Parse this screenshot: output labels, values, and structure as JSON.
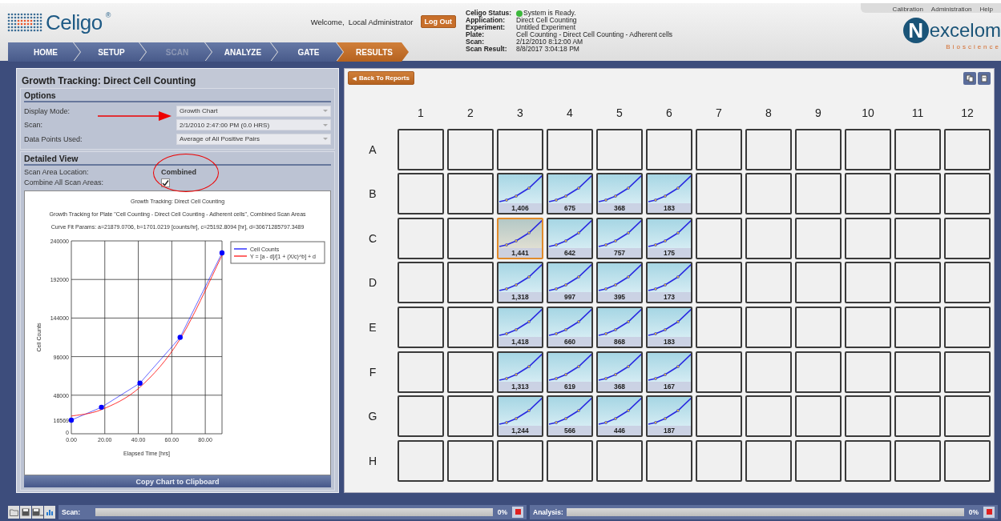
{
  "header": {
    "logo": "Celigo",
    "registered": "®",
    "welcome": "Welcome,",
    "user": "Local Administrator",
    "logout": "Log Out"
  },
  "nav": [
    {
      "label": "HOME",
      "selected": false,
      "disabled": false
    },
    {
      "label": "SETUP",
      "selected": false,
      "disabled": false
    },
    {
      "label": "SCAN",
      "selected": false,
      "disabled": true
    },
    {
      "label": "ANALYZE",
      "selected": false,
      "disabled": false
    },
    {
      "label": "GATE",
      "selected": false,
      "disabled": false
    },
    {
      "label": "RESULTS",
      "selected": true,
      "disabled": false
    }
  ],
  "status": [
    {
      "label": "Celigo Status:",
      "value": "System is Ready.",
      "color": "#3cb83c"
    },
    {
      "label": "Application:",
      "value": "Direct Cell Counting"
    },
    {
      "label": "Experiment:",
      "value": "Untitled Experiment"
    },
    {
      "label": "Plate:",
      "value": "Cell Counting - Direct Cell Counting - Adherent cells"
    },
    {
      "label": "Scan:",
      "value": "2/12/2010 8:12:00 AM"
    },
    {
      "label": "Scan Result:",
      "value": "8/8/2017 3:04:18 PM"
    }
  ],
  "top_links": [
    "Calibration",
    "Administration",
    "Help"
  ],
  "brand": {
    "name": "excelom",
    "initial": "N",
    "tagline": "Bioscience"
  },
  "left_panel": {
    "title": "Growth Tracking: Direct Cell Counting",
    "options": {
      "heading": "Options",
      "fields": [
        {
          "label": "Display Mode:",
          "value": "Growth Chart"
        },
        {
          "label": "Scan:",
          "value": "2/1/2010 2:47:00 PM (0.0 HRS)"
        },
        {
          "label": "Data Points Used:",
          "value": "Average of All Positive Pairs"
        }
      ]
    },
    "detailed_view": {
      "heading": "Detailed View",
      "scan_area_label": "Scan Area Location:",
      "scan_area_value": "Combined",
      "combine_label": "Combine All Scan Areas:",
      "combine_checked": true
    },
    "chart": {
      "lines": [
        "Growth Tracking: Direct Cell Counting",
        "Growth Tracking for Plate \"Cell Counting - Direct Cell Counting - Adherent cells\", Combined Scan Areas",
        "Curve Fit Params: a=21879.0706, b=1701.0219 [counts/hr], c=25192.8094 [hr], d=30671285797.3489"
      ],
      "chart_data": {
        "type": "line",
        "xlabel": "Elapsed Time [hrs]",
        "ylabel": "Cell Counts",
        "x": [
          0,
          18,
          41,
          65,
          90
        ],
        "series": [
          {
            "name": "Cell Counts",
            "color": "#0000ff",
            "marker": "circle",
            "values": [
              17000,
              33000,
              63000,
              120000,
              225000
            ]
          },
          {
            "name": "Y = [a - d]/[1 + (X/c)^b] + d",
            "color": "#ff0000",
            "values": [
              22000,
              30000,
              58000,
              118000,
              222000
            ]
          }
        ],
        "xlim": [
          0,
          90
        ],
        "ylim": [
          0,
          240000
        ],
        "xticks": [
          {
            "value": 0,
            "label": "0.00"
          },
          {
            "value": 20,
            "label": "20.00"
          },
          {
            "value": 40,
            "label": "40.00"
          },
          {
            "value": 60,
            "label": "60.00"
          },
          {
            "value": 80,
            "label": "80.00"
          }
        ],
        "yticks": [
          0,
          {
            "value": 16569,
            "label": "16569"
          },
          48000,
          96000,
          144000,
          192000,
          240000
        ],
        "grid": true,
        "legend": "upper right"
      }
    },
    "copy_button": "Copy Chart to Clipboard"
  },
  "plate": {
    "back_icon": "◀",
    "back_button": "Back To Reports",
    "columns": [
      "1",
      "2",
      "3",
      "4",
      "5",
      "6",
      "7",
      "8",
      "9",
      "10",
      "11",
      "12"
    ],
    "rows": [
      {
        "label": "A",
        "wells": [
          {
            "kind": "empty",
            "selected": false
          },
          {
            "kind": "empty",
            "selected": false
          },
          {
            "kind": "empty",
            "selected": false
          },
          {
            "kind": "empty",
            "selected": false
          },
          {
            "kind": "empty",
            "selected": false
          },
          {
            "kind": "empty",
            "selected": false
          },
          {
            "kind": "empty",
            "selected": false
          },
          {
            "kind": "empty",
            "selected": false
          },
          {
            "kind": "empty",
            "selected": false
          },
          {
            "kind": "empty",
            "selected": false
          },
          {
            "kind": "empty",
            "selected": false
          },
          {
            "kind": "empty",
            "selected": false
          }
        ]
      },
      {
        "label": "B",
        "wells": [
          {
            "kind": "empty",
            "selected": false
          },
          {
            "kind": "empty",
            "selected": false
          },
          {
            "kind": "chart",
            "count": "1,406",
            "selected": false
          },
          {
            "kind": "chart",
            "count": "675",
            "selected": false
          },
          {
            "kind": "chart",
            "count": "368",
            "selected": false
          },
          {
            "kind": "chart",
            "count": "183",
            "selected": false
          },
          {
            "kind": "empty",
            "selected": false
          },
          {
            "kind": "empty",
            "selected": false
          },
          {
            "kind": "empty",
            "selected": false
          },
          {
            "kind": "empty",
            "selected": false
          },
          {
            "kind": "empty",
            "selected": false
          },
          {
            "kind": "empty",
            "selected": false
          }
        ]
      },
      {
        "label": "C",
        "wells": [
          {
            "kind": "empty",
            "selected": false
          },
          {
            "kind": "empty",
            "selected": false
          },
          {
            "kind": "chart",
            "count": "1,441",
            "selected": true
          },
          {
            "kind": "chart",
            "count": "642",
            "selected": false
          },
          {
            "kind": "chart",
            "count": "757",
            "selected": false
          },
          {
            "kind": "chart",
            "count": "175",
            "selected": false
          },
          {
            "kind": "empty",
            "selected": false
          },
          {
            "kind": "empty",
            "selected": false
          },
          {
            "kind": "empty",
            "selected": false
          },
          {
            "kind": "empty",
            "selected": false
          },
          {
            "kind": "empty",
            "selected": false
          },
          {
            "kind": "empty",
            "selected": false
          }
        ]
      },
      {
        "label": "D",
        "wells": [
          {
            "kind": "empty",
            "selected": false
          },
          {
            "kind": "empty",
            "selected": false
          },
          {
            "kind": "chart",
            "count": "1,318",
            "selected": false
          },
          {
            "kind": "chart",
            "count": "997",
            "selected": false
          },
          {
            "kind": "chart",
            "count": "395",
            "selected": false
          },
          {
            "kind": "chart",
            "count": "173",
            "selected": false
          },
          {
            "kind": "empty",
            "selected": false
          },
          {
            "kind": "empty",
            "selected": false
          },
          {
            "kind": "empty",
            "selected": false
          },
          {
            "kind": "empty",
            "selected": false
          },
          {
            "kind": "empty",
            "selected": false
          },
          {
            "kind": "empty",
            "selected": false
          }
        ]
      },
      {
        "label": "E",
        "wells": [
          {
            "kind": "empty",
            "selected": false
          },
          {
            "kind": "empty",
            "selected": false
          },
          {
            "kind": "chart",
            "count": "1,418",
            "selected": false
          },
          {
            "kind": "chart",
            "count": "660",
            "selected": false
          },
          {
            "kind": "chart",
            "count": "868",
            "selected": false
          },
          {
            "kind": "chart",
            "count": "183",
            "selected": false
          },
          {
            "kind": "empty",
            "selected": false
          },
          {
            "kind": "empty",
            "selected": false
          },
          {
            "kind": "empty",
            "selected": false
          },
          {
            "kind": "empty",
            "selected": false
          },
          {
            "kind": "empty",
            "selected": false
          },
          {
            "kind": "empty",
            "selected": false
          }
        ]
      },
      {
        "label": "F",
        "wells": [
          {
            "kind": "empty",
            "selected": false
          },
          {
            "kind": "empty",
            "selected": false
          },
          {
            "kind": "chart",
            "count": "1,313",
            "selected": false
          },
          {
            "kind": "chart",
            "count": "619",
            "selected": false
          },
          {
            "kind": "chart",
            "count": "368",
            "selected": false
          },
          {
            "kind": "chart",
            "count": "167",
            "selected": false
          },
          {
            "kind": "empty",
            "selected": false
          },
          {
            "kind": "empty",
            "selected": false
          },
          {
            "kind": "empty",
            "selected": false
          },
          {
            "kind": "empty",
            "selected": false
          },
          {
            "kind": "empty",
            "selected": false
          },
          {
            "kind": "empty",
            "selected": false
          }
        ]
      },
      {
        "label": "G",
        "wells": [
          {
            "kind": "empty",
            "selected": false
          },
          {
            "kind": "empty",
            "selected": false
          },
          {
            "kind": "chart",
            "count": "1,244",
            "selected": false
          },
          {
            "kind": "chart",
            "count": "566",
            "selected": false
          },
          {
            "kind": "chart",
            "count": "446",
            "selected": false
          },
          {
            "kind": "chart",
            "count": "187",
            "selected": false
          },
          {
            "kind": "empty",
            "selected": false
          },
          {
            "kind": "empty",
            "selected": false
          },
          {
            "kind": "empty",
            "selected": false
          },
          {
            "kind": "empty",
            "selected": false
          },
          {
            "kind": "empty",
            "selected": false
          },
          {
            "kind": "empty",
            "selected": false
          }
        ]
      },
      {
        "label": "H",
        "wells": [
          {
            "kind": "empty",
            "selected": false
          },
          {
            "kind": "empty",
            "selected": false
          },
          {
            "kind": "empty",
            "selected": false
          },
          {
            "kind": "empty",
            "selected": false
          },
          {
            "kind": "empty",
            "selected": false
          },
          {
            "kind": "empty",
            "selected": false
          },
          {
            "kind": "empty",
            "selected": false
          },
          {
            "kind": "empty",
            "selected": false
          },
          {
            "kind": "empty",
            "selected": false
          },
          {
            "kind": "empty",
            "selected": false
          },
          {
            "kind": "empty",
            "selected": false
          },
          {
            "kind": "empty",
            "selected": false
          }
        ]
      }
    ]
  },
  "status_bar": [
    {
      "label": "Scan:",
      "percent": "0%",
      "level": 0
    },
    {
      "label": "Analysis:",
      "percent": "0%",
      "level": 0
    }
  ]
}
